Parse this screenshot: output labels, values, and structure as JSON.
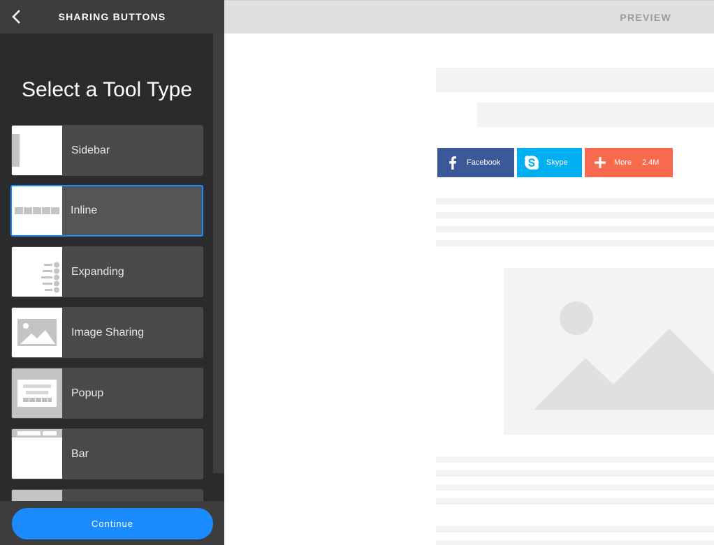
{
  "sidebar": {
    "title": "SHARING BUTTONS",
    "heading": "Select a Tool Type",
    "items": [
      {
        "label": "Sidebar"
      },
      {
        "label": "Inline"
      },
      {
        "label": "Expanding"
      },
      {
        "label": "Image Sharing"
      },
      {
        "label": "Popup"
      },
      {
        "label": "Bar"
      }
    ],
    "selected": "Inline",
    "continue_label": "Continue"
  },
  "preview": {
    "label": "PREVIEW",
    "share_buttons": [
      {
        "label": "Facebook",
        "icon": "facebook-icon",
        "color": "#3b5998"
      },
      {
        "label": "Skype",
        "icon": "skype-icon",
        "color": "#00aff0"
      },
      {
        "label": "More",
        "count": "2.4M",
        "icon": "plus-icon",
        "color": "#f8694d"
      }
    ]
  },
  "colors": {
    "accent": "#1a8cff",
    "sidebar_bg": "#2b2b2b",
    "item_bg": "#4a4a4a"
  }
}
